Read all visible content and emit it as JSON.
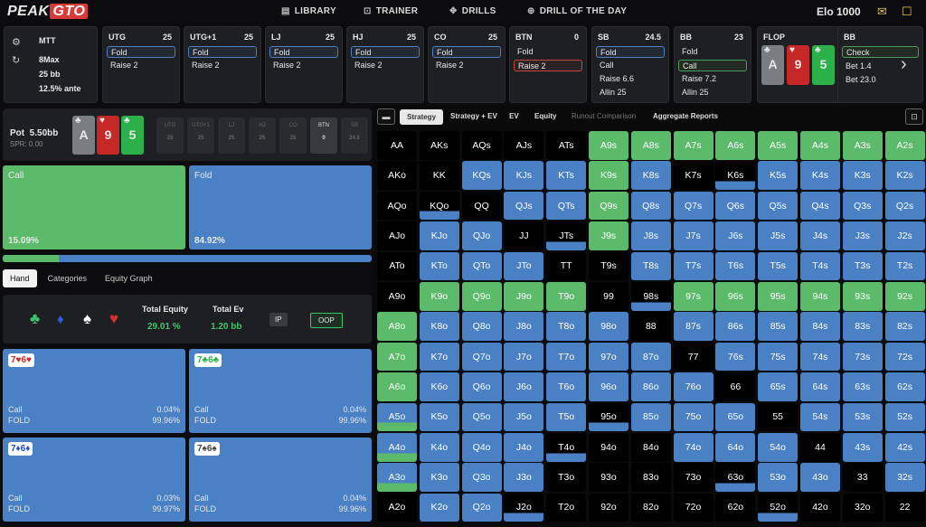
{
  "nav": {
    "logo_a": "PEAK",
    "logo_b": "GTO",
    "items": [
      {
        "label": "LIBRARY",
        "icon": "book-icon"
      },
      {
        "label": "TRAINER",
        "icon": "gamepad-icon"
      },
      {
        "label": "DRILLS",
        "icon": "target-icon"
      },
      {
        "label": "DRILL OF THE DAY",
        "icon": "plus-circle-icon"
      }
    ],
    "elo": "Elo 1000"
  },
  "game": {
    "type": "MTT",
    "format": "8Max",
    "stack": "25 bb",
    "ante": "12.5% ante"
  },
  "positions": [
    {
      "name": "UTG",
      "stack": "25",
      "actions": [
        "Fold",
        "Raise 2"
      ],
      "sel": 0
    },
    {
      "name": "UTG+1",
      "stack": "25",
      "actions": [
        "Fold",
        "Raise 2"
      ],
      "sel": 0
    },
    {
      "name": "LJ",
      "stack": "25",
      "actions": [
        "Fold",
        "Raise 2"
      ],
      "sel": 0
    },
    {
      "name": "HJ",
      "stack": "25",
      "actions": [
        "Fold",
        "Raise 2"
      ],
      "sel": 0
    },
    {
      "name": "CO",
      "stack": "25",
      "actions": [
        "Fold",
        "Raise 2"
      ],
      "sel": 0
    },
    {
      "name": "BTN",
      "stack": "0",
      "actions": [
        "Fold",
        "Raise 2"
      ],
      "sel": 1
    },
    {
      "name": "SB",
      "stack": "24.5",
      "actions": [
        "Fold",
        "Call",
        "Raise 6.6",
        "Allin 25"
      ],
      "sel": 0
    },
    {
      "name": "BB",
      "stack": "23",
      "actions": [
        "Fold",
        "Call",
        "Raise 7.2",
        "Allin 25"
      ],
      "sel": 1
    }
  ],
  "flop": {
    "name": "FLOP",
    "cards": [
      {
        "rank": "A",
        "suit": "♣",
        "color": "gray"
      },
      {
        "rank": "9",
        "suit": "♥",
        "color": "red"
      },
      {
        "rank": "5",
        "suit": "♣",
        "color": "green"
      }
    ]
  },
  "bb2": {
    "name": "BB",
    "actions": [
      "Check",
      "Bet 1.4",
      "Bet 23.0"
    ]
  },
  "pot": {
    "label": "Pot",
    "value": "5.50bb",
    "spr": "SPR: 0.00",
    "mini": [
      {
        "n": "UTG",
        "v": "25"
      },
      {
        "n": "UTG+1",
        "v": "25"
      },
      {
        "n": "LJ",
        "v": "25"
      },
      {
        "n": "HJ",
        "v": "25"
      },
      {
        "n": "CO",
        "v": "25"
      },
      {
        "n": "BTN",
        "v": "0"
      },
      {
        "n": "SB",
        "v": "24.5"
      }
    ]
  },
  "strategy": {
    "call_label": "Call",
    "call_pct": "15.09%",
    "fold_label": "Fold",
    "fold_pct": "84.92%",
    "call_fraction": 0.1509
  },
  "lefttabs": [
    "Hand",
    "Categories",
    "Equity Graph"
  ],
  "equity": {
    "total_equity_label": "Total Equity",
    "total_equity": "29.01 %",
    "total_ev_label": "Total Ev",
    "total_ev": "1.20 bb",
    "ip": "IP",
    "oop": "OOP"
  },
  "combos": [
    {
      "hand": "7♥6♥",
      "hcolor": "#c62828",
      "call": "Call",
      "call_v": "0.04%",
      "fold": "FOLD",
      "fold_v": "99.96%"
    },
    {
      "hand": "7♣6♣",
      "hcolor": "#2bb04a",
      "call": "Call",
      "call_v": "0.04%",
      "fold": "FOLD",
      "fold_v": "99.96%"
    },
    {
      "hand": "7♦6♦",
      "hcolor": "#1d4ed8",
      "call": "Call",
      "call_v": "0.03%",
      "fold": "FOLD",
      "fold_v": "99.97%"
    },
    {
      "hand": "7♠6♠",
      "hcolor": "#444",
      "call": "Call",
      "call_v": "0.04%",
      "fold": "FOLD",
      "fold_v": "99.96%"
    }
  ],
  "righttabs": {
    "strategy": "Strategy",
    "strategy_ev": "Strategy + EV",
    "ev": "EV",
    "equity": "Equity",
    "runout": "Runout Comparison",
    "aggregate": "Aggregate Reports"
  },
  "grid": [
    [
      "AA",
      "AKs",
      "AQs",
      "AJs",
      "ATs",
      "A9s",
      "A8s",
      "A7s",
      "A6s",
      "A5s",
      "A4s",
      "A3s",
      "A2s"
    ],
    [
      "AKo",
      "KK",
      "KQs",
      "KJs",
      "KTs",
      "K9s",
      "K8s",
      "K7s",
      "K6s",
      "K5s",
      "K4s",
      "K3s",
      "K2s"
    ],
    [
      "AQo",
      "KQo",
      "QQ",
      "QJs",
      "QTs",
      "Q9s",
      "Q8s",
      "Q7s",
      "Q6s",
      "Q5s",
      "Q4s",
      "Q3s",
      "Q2s"
    ],
    [
      "AJo",
      "KJo",
      "QJo",
      "JJ",
      "JTs",
      "J9s",
      "J8s",
      "J7s",
      "J6s",
      "J5s",
      "J4s",
      "J3s",
      "J2s"
    ],
    [
      "ATo",
      "KTo",
      "QTo",
      "JTo",
      "TT",
      "T9s",
      "T8s",
      "T7s",
      "T6s",
      "T5s",
      "T4s",
      "T3s",
      "T2s"
    ],
    [
      "A9o",
      "K9o",
      "Q9o",
      "J9o",
      "T9o",
      "99",
      "98s",
      "97s",
      "96s",
      "95s",
      "94s",
      "93s",
      "92s"
    ],
    [
      "A8o",
      "K8o",
      "Q8o",
      "J8o",
      "T8o",
      "98o",
      "88",
      "87s",
      "86s",
      "85s",
      "84s",
      "83s",
      "82s"
    ],
    [
      "A7o",
      "K7o",
      "Q7o",
      "J7o",
      "T7o",
      "97o",
      "87o",
      "77",
      "76s",
      "75s",
      "74s",
      "73s",
      "72s"
    ],
    [
      "A6o",
      "K6o",
      "Q6o",
      "J6o",
      "T6o",
      "96o",
      "86o",
      "76o",
      "66",
      "65s",
      "64s",
      "63s",
      "62s"
    ],
    [
      "A5o",
      "K5o",
      "Q5o",
      "J5o",
      "T5o",
      "95o",
      "85o",
      "75o",
      "65o",
      "55",
      "54s",
      "53s",
      "52s"
    ],
    [
      "A4o",
      "K4o",
      "Q4o",
      "J4o",
      "T4o",
      "94o",
      "84o",
      "74o",
      "64o",
      "54o",
      "44",
      "43s",
      "42s"
    ],
    [
      "A3o",
      "K3o",
      "Q3o",
      "J3o",
      "T3o",
      "93o",
      "83o",
      "73o",
      "63o",
      "53o",
      "43o",
      "33",
      "32s"
    ],
    [
      "A2o",
      "K2o",
      "Q2o",
      "J2o",
      "T2o",
      "92o",
      "82o",
      "72o",
      "62o",
      "52o",
      "42o",
      "32o",
      "22"
    ]
  ],
  "cellstate": [
    [
      "x",
      "x",
      "x",
      "x",
      "x",
      "g",
      "g",
      "g",
      "g",
      "g",
      "g",
      "g",
      "g"
    ],
    [
      "x",
      "x",
      "b",
      "b",
      "b",
      "g",
      "b",
      "x",
      "b2",
      "b",
      "b",
      "b",
      "b"
    ],
    [
      "x",
      "b2",
      "x",
      "b",
      "b",
      "g",
      "b",
      "b",
      "b",
      "b",
      "b",
      "b",
      "b"
    ],
    [
      "x",
      "b",
      "b",
      "x",
      "b2",
      "g",
      "b",
      "b",
      "b",
      "b",
      "b",
      "b",
      "b"
    ],
    [
      "x",
      "b",
      "b",
      "b",
      "x",
      "x",
      "b",
      "b",
      "b",
      "b",
      "b",
      "b",
      "b"
    ],
    [
      "x",
      "g",
      "g",
      "g",
      "g",
      "x",
      "b2",
      "g",
      "g",
      "g",
      "g",
      "g",
      "g"
    ],
    [
      "g",
      "b",
      "b",
      "b",
      "b",
      "b",
      "x",
      "b",
      "b",
      "b",
      "b",
      "b",
      "b"
    ],
    [
      "g",
      "b",
      "b",
      "b",
      "b",
      "b",
      "b",
      "x",
      "b",
      "b",
      "b",
      "b",
      "b"
    ],
    [
      "g",
      "b",
      "b",
      "b",
      "b",
      "b",
      "b",
      "b",
      "x",
      "b",
      "b",
      "b",
      "b"
    ],
    [
      "g2",
      "b",
      "b",
      "b",
      "b",
      "b2",
      "b",
      "b",
      "b",
      "x",
      "b",
      "b",
      "b"
    ],
    [
      "g2",
      "b",
      "b",
      "b",
      "b2",
      "x",
      "x",
      "b",
      "b",
      "b",
      "x",
      "b",
      "b"
    ],
    [
      "g2",
      "b",
      "b",
      "b",
      "x",
      "x",
      "x",
      "x",
      "b2",
      "b",
      "b",
      "x",
      "b"
    ],
    [
      "x",
      "b",
      "b",
      "b2",
      "x",
      "x",
      "x",
      "x",
      "x",
      "b2",
      "x",
      "x",
      "x"
    ]
  ],
  "colors": {
    "call": "#5cbb6a",
    "fold": "#4a80c4",
    "raise": "#c94444"
  }
}
